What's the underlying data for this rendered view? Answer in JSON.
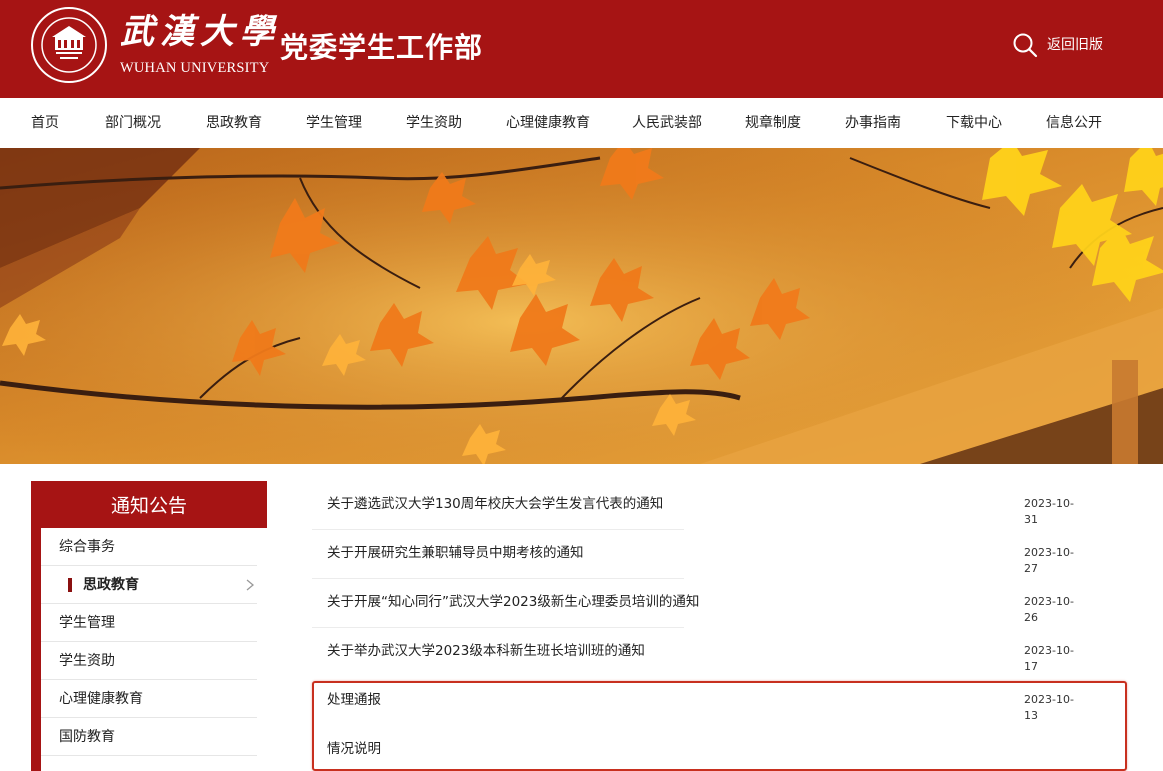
{
  "header": {
    "university_name_cn": "武漢大學",
    "university_name_en": "WUHAN UNIVERSITY",
    "department_title": "党委学生工作部",
    "old_version_link": "返回旧版",
    "brand_color": "#a61414"
  },
  "nav": {
    "items": [
      "首页",
      "部门概况",
      "思政教育",
      "学生管理",
      "学生资助",
      "心理健康教育",
      "人民武装部",
      "规章制度",
      "办事指南",
      "下载中心",
      "信息公开"
    ]
  },
  "sidebar": {
    "heading": "通知公告",
    "items": [
      {
        "label": "综合事务",
        "active": false
      },
      {
        "label": "思政教育",
        "active": true
      },
      {
        "label": "学生管理",
        "active": false
      },
      {
        "label": "学生资助",
        "active": false
      },
      {
        "label": "心理健康教育",
        "active": false
      },
      {
        "label": "国防教育",
        "active": false
      }
    ]
  },
  "news": [
    {
      "title": "关于遴选武汉大学130周年校庆大会学生发言代表的通知",
      "date": "2023-10-31"
    },
    {
      "title": "关于开展研究生兼职辅导员中期考核的通知",
      "date": "2023-10-27"
    },
    {
      "title": "关于开展“知心同行”武汉大学2023级新生心理委员培训的通知",
      "date": "2023-10-26"
    },
    {
      "title": "关于举办武汉大学2023级本科新生班长培训班的通知",
      "date": "2023-10-17"
    },
    {
      "title": "处理通报",
      "date": "2023-10-13"
    },
    {
      "title": "情况说明",
      "date": ""
    }
  ],
  "icons": {
    "search": "search-icon",
    "seal": "university-seal-icon",
    "chevron": "chevron-right-icon"
  },
  "highlight_color": "#c8301f"
}
